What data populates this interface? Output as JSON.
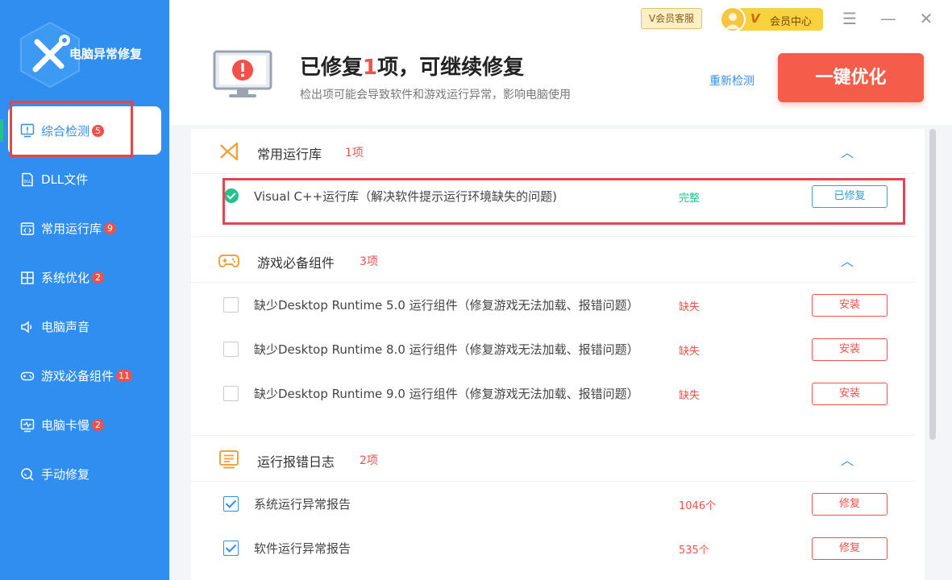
{
  "app": {
    "title": "电脑异常修复"
  },
  "sidebar": {
    "items": [
      {
        "label": "综合检测",
        "badge": "5",
        "icon": "monitor-alert-icon"
      },
      {
        "label": "DLL文件",
        "badge": "",
        "icon": "dll-file-icon"
      },
      {
        "label": "常用运行库",
        "badge": "9",
        "icon": "code-window-icon"
      },
      {
        "label": "系统优化",
        "badge": "2",
        "icon": "windows-icon"
      },
      {
        "label": "电脑声音",
        "badge": "",
        "icon": "speaker-icon"
      },
      {
        "label": "游戏必备组件",
        "badge": "11",
        "icon": "gamepad-icon"
      },
      {
        "label": "电脑卡慢",
        "badge": "2",
        "icon": "pulse-monitor-icon"
      },
      {
        "label": "手动修复",
        "badge": "",
        "icon": "search-repair-icon"
      }
    ]
  },
  "topbar": {
    "vip_service": "V会员客服",
    "member_v": "V",
    "member_center": "会员中心",
    "menu_icon": "☰",
    "minimize_icon": "—",
    "close_icon": "✕"
  },
  "header": {
    "headline_prefix": "已修复",
    "headline_num": "1",
    "headline_suffix": "项，可继续修复",
    "subline": "检出项可能会导致软件和游戏运行异常，影响电脑使用",
    "recheck": "重新检测",
    "optimize": "一键优化"
  },
  "sections": [
    {
      "title": "常用运行库",
      "count": "1项",
      "rows": [
        {
          "title": "Visual C++运行库（解决软件提示运行环境缺失的问题)",
          "status": "完整",
          "button": "已修复"
        }
      ]
    },
    {
      "title": "游戏必备组件",
      "count": "3项",
      "rows": [
        {
          "title": "缺少Desktop Runtime 5.0 运行组件（修复游戏无法加载、报错问题）",
          "status": "缺失",
          "button": "安装"
        },
        {
          "title": "缺少Desktop Runtime 8.0 运行组件（修复游戏无法加载、报错问题）",
          "status": "缺失",
          "button": "安装"
        },
        {
          "title": "缺少Desktop Runtime 9.0 运行组件（修复游戏无法加载、报错问题）",
          "status": "缺失",
          "button": "安装"
        }
      ]
    },
    {
      "title": "运行报错日志",
      "count": "2项",
      "rows": [
        {
          "title": "系统运行异常报告",
          "status": "1046个",
          "button": "修复"
        },
        {
          "title": "软件运行异常报告",
          "status": "535个",
          "button": "修复"
        }
      ]
    }
  ],
  "colors": {
    "sidebar_bg": "#2f8ef0",
    "accent_red": "#f2514a",
    "ok_green": "#21c38b",
    "optimize_btn": "#f55c4a"
  }
}
